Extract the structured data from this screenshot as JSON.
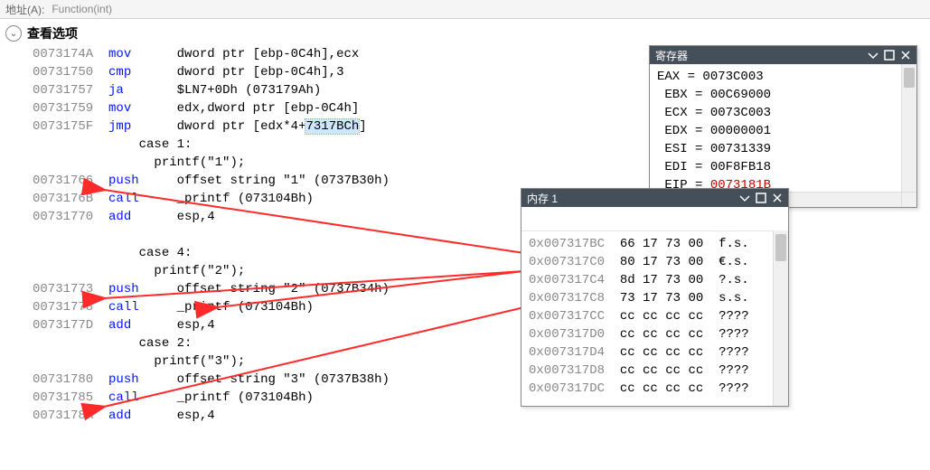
{
  "topbar": {
    "address_label": "地址(A):",
    "fn": "Function(int)"
  },
  "options_label": "查看选项",
  "disasm_lines": [
    {
      "addr": "0073174A",
      "mnem": "mov",
      "op": "dword ptr [ebp-0C4h],ecx"
    },
    {
      "addr": "00731750",
      "mnem": "cmp",
      "op": "dword ptr [ebp-0C4h],3"
    },
    {
      "addr": "00731757",
      "mnem": "ja",
      "op": "$LN7+0Dh (073179Ah)"
    },
    {
      "addr": "00731759",
      "mnem": "mov",
      "op": "edx,dword ptr [ebp-0C4h]"
    },
    {
      "addr": "0073175F",
      "mnem": "jmp",
      "op": "dword ptr [edx*4+",
      "hl": "7317BCh",
      "op2": "]"
    },
    {
      "indent": 2,
      "cmt": "case 1:"
    },
    {
      "indent": 3,
      "cmt": "printf(\"1\");"
    },
    {
      "addr": "00731766",
      "mnem": "push",
      "op": "offset string \"1\" (0737B30h)"
    },
    {
      "addr": "0073176B",
      "mnem": "call",
      "op": "_printf (073104Bh)"
    },
    {
      "addr": "00731770",
      "mnem": "add",
      "op": "esp,4"
    },
    {
      "empty": true
    },
    {
      "indent": 2,
      "cmt": "case 4:"
    },
    {
      "indent": 3,
      "cmt": "printf(\"2\");"
    },
    {
      "addr": "00731773",
      "mnem": "push",
      "op": "offset string \"2\" (0737B34h)"
    },
    {
      "addr": "00731778",
      "mnem": "call",
      "op": "_printf (073104Bh)"
    },
    {
      "addr": "0073177D",
      "mnem": "add",
      "op": "esp,4"
    },
    {
      "indent": 2,
      "cmt": "case 2:"
    },
    {
      "indent": 3,
      "cmt": "printf(\"3\");"
    },
    {
      "addr": "00731780",
      "mnem": "push",
      "op": "offset string \"3\" (0737B38h)"
    },
    {
      "addr": "00731785",
      "mnem": "call",
      "op": "_printf (073104Bh)"
    },
    {
      "addr": "0073178A",
      "mnem": "add",
      "op": "esp,4"
    }
  ],
  "memory": {
    "title": "内存 1",
    "rows": [
      {
        "addr": "0x007317BC",
        "hex": "66 17 73 00",
        "asc": "f.s."
      },
      {
        "addr": "0x007317C0",
        "hex": "80 17 73 00",
        "asc": "€.s."
      },
      {
        "addr": "0x007317C4",
        "hex": "8d 17 73 00",
        "asc": "?.s."
      },
      {
        "addr": "0x007317C8",
        "hex": "73 17 73 00",
        "asc": "s.s."
      },
      {
        "addr": "0x007317CC",
        "hex": "cc cc cc cc",
        "asc": "????"
      },
      {
        "addr": "0x007317D0",
        "hex": "cc cc cc cc",
        "asc": "????"
      },
      {
        "addr": "0x007317D4",
        "hex": "cc cc cc cc",
        "asc": "????"
      },
      {
        "addr": "0x007317D8",
        "hex": "cc cc cc cc",
        "asc": "????"
      },
      {
        "addr": "0x007317DC",
        "hex": "cc cc cc cc",
        "asc": "????"
      }
    ]
  },
  "registers": {
    "title": "寄存器",
    "rows": [
      {
        "name": "EAX",
        "val": "0073C003",
        "pad": 0
      },
      {
        "name": "EBX",
        "val": "00C69000",
        "pad": 1
      },
      {
        "name": "ECX",
        "val": "0073C003",
        "pad": 1
      },
      {
        "name": "EDX",
        "val": "00000001",
        "pad": 1
      },
      {
        "name": "ESI",
        "val": "00731339",
        "pad": 1
      },
      {
        "name": "EDI",
        "val": "00F8FB18",
        "pad": 1,
        "clip": true
      },
      {
        "name": "EIP",
        "val": "0073181B",
        "pad": 1,
        "red": true,
        "clip": true
      }
    ]
  }
}
